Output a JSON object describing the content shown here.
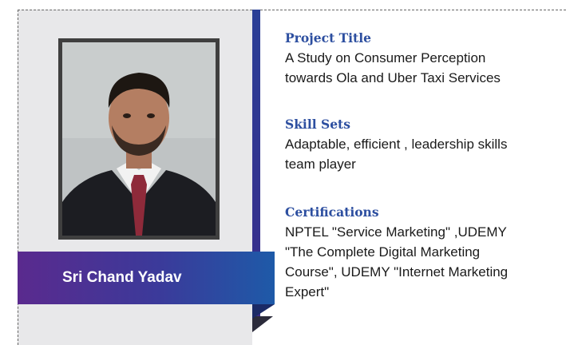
{
  "profile": {
    "name": "Sri Chand Yadav"
  },
  "sections": [
    {
      "label": "Project Title",
      "lines": [
        "A Study on Consumer Perception",
        "towards Ola and Uber Taxi Services"
      ]
    },
    {
      "label": "Skill Sets",
      "lines": [
        "Adaptable, efficient , leadership skills",
        "team player"
      ]
    },
    {
      "label": "Certifications",
      "lines": [
        "NPTEL \"Service Marketing\" ,UDEMY",
        "\"The Complete Digital Marketing",
        "Course\", UDEMY \"Internet Marketing",
        "Expert\""
      ]
    }
  ],
  "colors": {
    "accent": "#2d4fa0",
    "name_bar_start": "#5a2a8e",
    "name_bar_end": "#1e5aa8",
    "panel": "#e8e8ea"
  }
}
